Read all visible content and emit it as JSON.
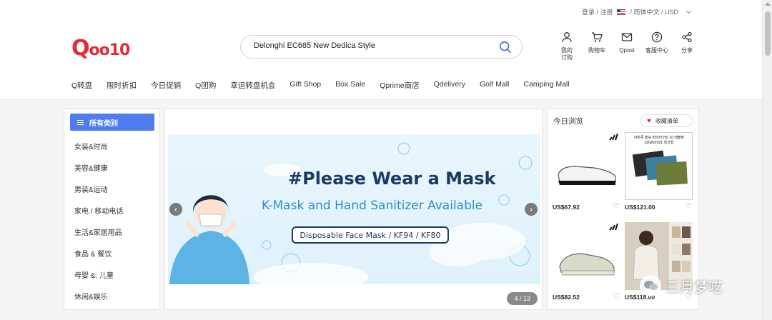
{
  "utility": {
    "login": "登录 / 注册",
    "locale": "/ 简体中文 / USD"
  },
  "logo": {
    "text": "Qoo10"
  },
  "search": {
    "value": "Delonghi EC685 New Dedica Style"
  },
  "header_icons": [
    {
      "label": "我的\n订购",
      "icon": "user-icon"
    },
    {
      "label": "购物车",
      "icon": "cart-icon"
    },
    {
      "label": "Qpost",
      "icon": "mail-icon"
    },
    {
      "label": "客服中心",
      "icon": "help-icon"
    },
    {
      "label": "分享",
      "icon": "share-icon"
    }
  ],
  "nav": [
    "Q转盘",
    "限时折扣",
    "今日促销",
    "Q团购",
    "幸运转盘机会",
    "Gift Shop",
    "Box Sale",
    "Qprime商店",
    "Qdelivery",
    "Golf Mall",
    "Camping Mall"
  ],
  "categories": {
    "header": "所有类别",
    "items": [
      "女装&时尚",
      "美容&健康",
      "男装&运动",
      "家电 / 移动电话",
      "生活&家居用品",
      "食品 & 餐饮",
      "母婴 &: 儿童",
      "休闲&娱乐"
    ]
  },
  "banner": {
    "headline": "#Please Wear a Mask",
    "subline": "K-Mask and Hand Sanitizer Available",
    "pill": "Disposable Face Mask / KF94 / KF80",
    "pager": "4 / 13"
  },
  "recent": {
    "title": "今日浏览",
    "wishlist_label": "收藏清单",
    "products": [
      {
        "price": "US$67.92",
        "kind": "sneaker"
      },
      {
        "price": "US$121.00",
        "kind": "tablet",
        "caption": "아마존 올뉴 파이어 HD 10 태블릿 32GB/2021 최신형"
      },
      {
        "price": "US$82.52",
        "kind": "sneaker"
      },
      {
        "price": "US$118.00",
        "kind": "fleece"
      }
    ]
  },
  "watermark": {
    "text": "三月梦呓"
  },
  "colors": {
    "brand": "#e52935",
    "accent": "#4f7cf3",
    "navy": "#1d3a66"
  }
}
